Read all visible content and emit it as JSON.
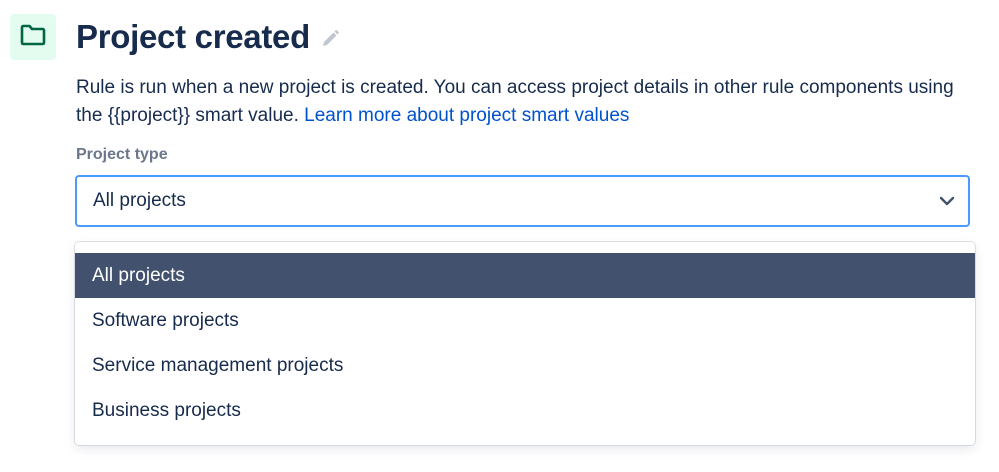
{
  "header": {
    "icon": "folder-icon",
    "title": "Project created",
    "edit_icon": "pencil-icon"
  },
  "description": {
    "text": "Rule is run when a new project is created. You can access project details in other rule components using the {{project}} smart value. ",
    "link_text": "Learn more about project smart values"
  },
  "project_type": {
    "label": "Project type",
    "selected_value": "All projects",
    "options": [
      {
        "label": "All projects",
        "selected": true
      },
      {
        "label": "Software projects",
        "selected": false
      },
      {
        "label": "Service management projects",
        "selected": false
      },
      {
        "label": "Business projects",
        "selected": false
      }
    ]
  },
  "colors": {
    "accent_blue": "#0052cc",
    "focus_border": "#4c9aff",
    "selected_option_bg": "#42526e",
    "icon_tile_bg": "#e3fcef",
    "icon_green": "#006644"
  }
}
